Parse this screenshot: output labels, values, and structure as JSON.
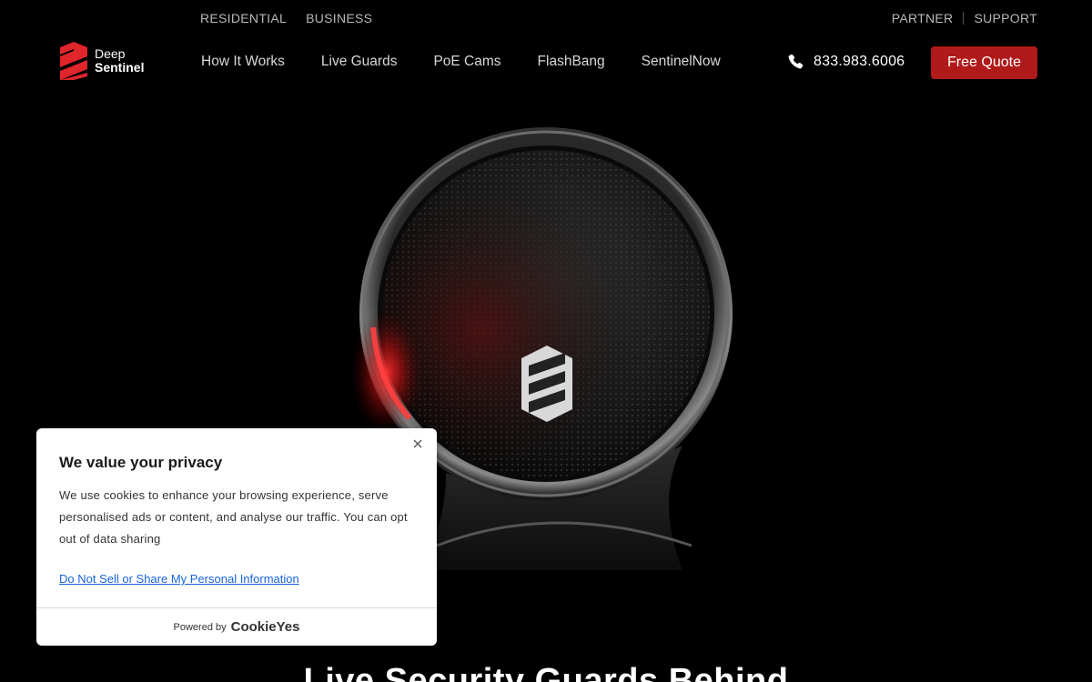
{
  "topbar": {
    "left_links": [
      "RESIDENTIAL",
      "BUSINESS"
    ],
    "right_links": [
      "PARTNER",
      "SUPPORT"
    ]
  },
  "brand": {
    "name_line1": "Deep",
    "name_line2": "Sentinel",
    "logo_icon": "shield-logo-icon",
    "accent_color": "#b01a1a"
  },
  "nav": {
    "items": [
      "How It Works",
      "Live Guards",
      "PoE Cams",
      "FlashBang",
      "SentinelNow"
    ],
    "phone": "833.983.6006",
    "phone_icon": "phone-icon",
    "cta_label": "Free Quote"
  },
  "hero": {
    "headline": "Live Security Guards Behind"
  },
  "cookie_banner": {
    "title": "We value your privacy",
    "body": "We use cookies to enhance your browsing experience, serve personalised ads or content, and analyse our traffic. You can opt out of data sharing",
    "do_not_sell_link": "Do Not Sell or Share My Personal Information",
    "powered_by": "Powered by",
    "brand": "CookieYes",
    "close_icon": "close-icon",
    "link_color": "#1863dc"
  }
}
